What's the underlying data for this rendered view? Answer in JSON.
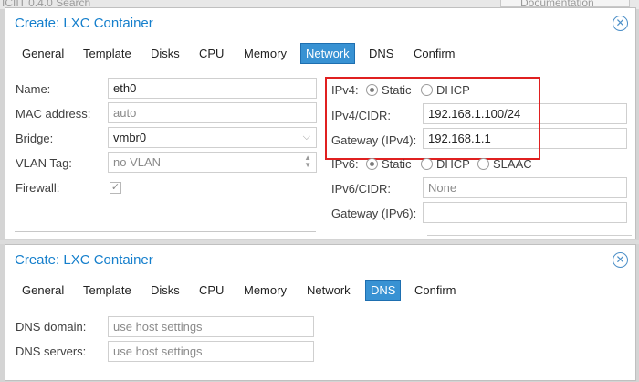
{
  "background": {
    "top_fragment": "ICIIT 0.4.0  Search",
    "top_right_fragment": "Documentation"
  },
  "window1": {
    "title": "Create: LXC Container",
    "tabs": [
      "General",
      "Template",
      "Disks",
      "CPU",
      "Memory",
      "Network",
      "DNS",
      "Confirm"
    ],
    "active_tab": "Network",
    "left_form": {
      "name_label": "Name:",
      "name_value": "eth0",
      "mac_label": "MAC address:",
      "mac_placeholder": "auto",
      "bridge_label": "Bridge:",
      "bridge_value": "vmbr0",
      "vlan_label": "VLAN Tag:",
      "vlan_placeholder": "no VLAN",
      "firewall_label": "Firewall:",
      "firewall_checked": true
    },
    "right_form": {
      "ipv4_label": "IPv4:",
      "ipv4_static": "Static",
      "ipv4_dhcp": "DHCP",
      "ipv4_selected": "Static",
      "ipv4_cidr_label": "IPv4/CIDR:",
      "ipv4_cidr_value": "192.168.1.100/24",
      "gateway4_label": "Gateway (IPv4):",
      "gateway4_value": "192.168.1.1",
      "ipv6_label": "IPv6:",
      "ipv6_static": "Static",
      "ipv6_dhcp": "DHCP",
      "ipv6_slaac": "SLAAC",
      "ipv6_selected": "Static",
      "ipv6_cidr_label": "IPv6/CIDR:",
      "ipv6_cidr_placeholder": "None",
      "gateway6_label": "Gateway (IPv6):",
      "gateway6_value": ""
    },
    "highlight_color": "#e02020"
  },
  "window2": {
    "title": "Create: LXC Container",
    "tabs": [
      "General",
      "Template",
      "Disks",
      "CPU",
      "Memory",
      "Network",
      "DNS",
      "Confirm"
    ],
    "active_tab": "DNS",
    "form": {
      "dns_domain_label": "DNS domain:",
      "dns_domain_placeholder": "use host settings",
      "dns_servers_label": "DNS servers:",
      "dns_servers_placeholder": "use host settings"
    }
  },
  "colors": {
    "accent": "#157fcc",
    "active_tab_bg": "#3892d3"
  },
  "icons": {
    "close": "close-circle-icon",
    "dropdown": "chevron-down-icon",
    "spinner": "spinner-arrows-icon",
    "checkbox": "checkmark-icon"
  }
}
